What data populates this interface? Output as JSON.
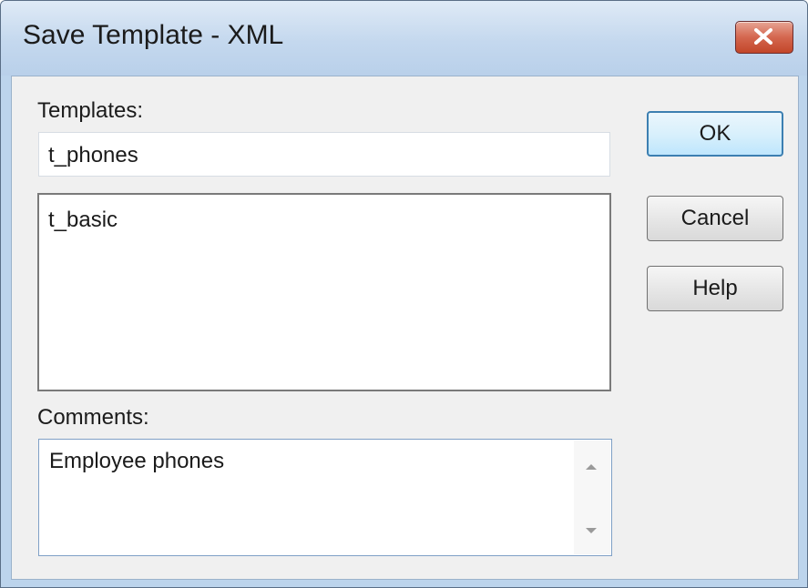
{
  "window": {
    "title": "Save Template - XML",
    "close_icon": "close-icon"
  },
  "templates": {
    "label": "Templates:",
    "value": "t_phones",
    "items": [
      "t_basic"
    ]
  },
  "comments": {
    "label": "Comments:",
    "value": "Employee phones"
  },
  "buttons": {
    "ok": "OK",
    "cancel": "Cancel",
    "help": "Help"
  }
}
